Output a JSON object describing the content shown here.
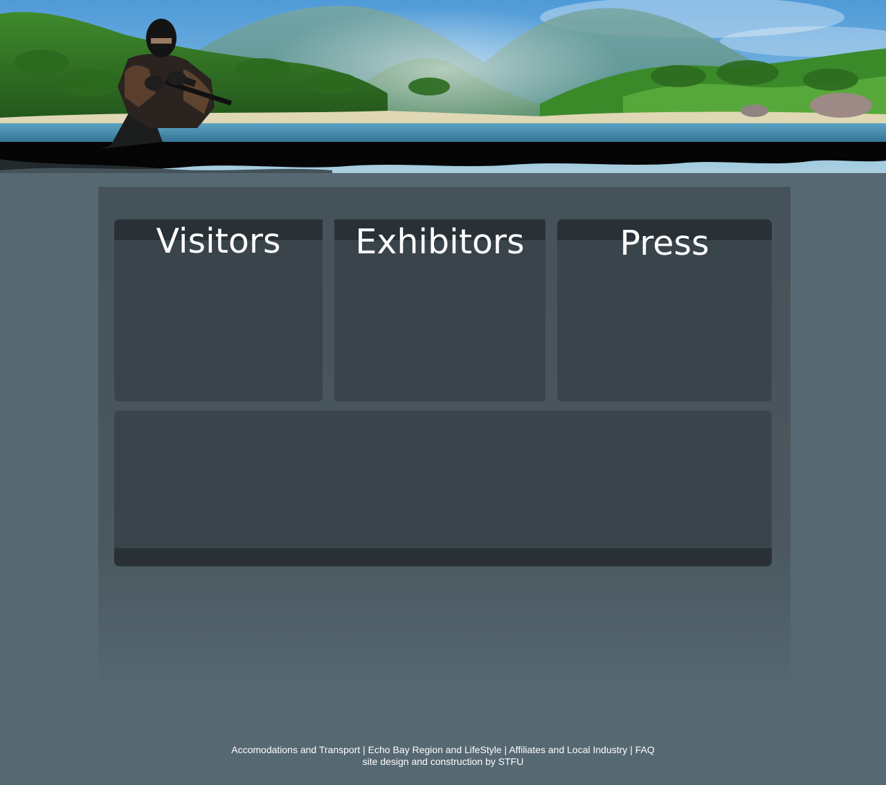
{
  "sections": {
    "visitors_title": "Visitors",
    "exhibitors_title": "Exhibitors",
    "press_title": "Press"
  },
  "footer": {
    "links": [
      "Accomodations and Transport",
      "Echo Bay Region and LifeStyle",
      "Affiliates and Local Industry",
      "FAQ"
    ],
    "separator": "|",
    "credit": "site design and construction by STFU"
  },
  "colors": {
    "page_background": "#566872",
    "panel_background": "#465259",
    "box_background": "#3a444b",
    "box_bar": "#293137",
    "text": "#ffffff"
  },
  "icons": {
    "banner": "tropical-island-banner",
    "soldier": "soldier-figure"
  }
}
